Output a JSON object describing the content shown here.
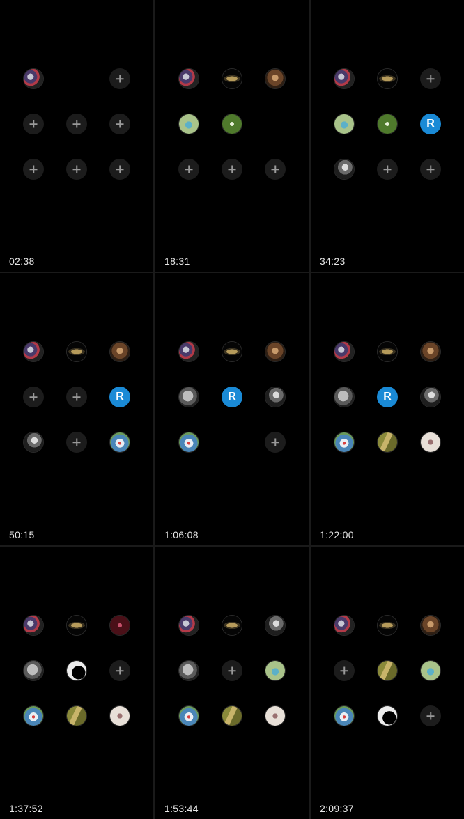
{
  "panels": [
    {
      "time": "02:38",
      "slots": [
        [
          "cards",
          null,
          "add"
        ],
        [
          "add",
          "add",
          "add"
        ],
        [
          "add",
          "add",
          "add"
        ]
      ]
    },
    {
      "time": "18:31",
      "slots": [
        [
          "cards",
          "car-logo",
          "coffee"
        ],
        [
          "drink",
          "saudi-emblem",
          null
        ],
        [
          "add",
          "add",
          "add"
        ]
      ]
    },
    {
      "time": "34:23",
      "slots": [
        [
          "cards",
          "car-logo",
          "add"
        ],
        [
          "drink",
          "saudi-emblem",
          "letter-r"
        ],
        [
          "portrait-bw",
          "add",
          "add"
        ]
      ]
    },
    {
      "time": "50:15",
      "slots": [
        [
          "cards",
          "car-logo",
          "coffee"
        ],
        [
          "add",
          "add",
          "letter-r"
        ],
        [
          "portrait-bw",
          "add",
          "flag-photo"
        ]
      ]
    },
    {
      "time": "1:06:08",
      "slots": [
        [
          "cards",
          "car-logo",
          "coffee"
        ],
        [
          "moon",
          "letter-r",
          "portrait-bw"
        ],
        [
          "flag-photo",
          null,
          "add"
        ]
      ]
    },
    {
      "time": "1:22:00",
      "slots": [
        [
          "cards",
          "car-logo",
          "coffee"
        ],
        [
          "moon",
          "letter-r",
          "portrait-bw"
        ],
        [
          "flag-photo",
          "road",
          "sketch"
        ]
      ]
    },
    {
      "time": "1:37:52",
      "slots": [
        [
          "cards",
          "car-logo",
          "palm-red"
        ],
        [
          "moon",
          "silhouette",
          "add"
        ],
        [
          "flag-photo",
          "road",
          "sketch"
        ]
      ]
    },
    {
      "time": "1:53:44",
      "slots": [
        [
          "cards",
          "car-logo",
          "portrait-bw"
        ],
        [
          "moon",
          "add",
          "drink"
        ],
        [
          "flag-photo",
          "road",
          "sketch"
        ]
      ]
    },
    {
      "time": "2:09:37",
      "slots": [
        [
          "cards",
          "car-logo",
          "coffee"
        ],
        [
          "add",
          "road",
          "drink"
        ],
        [
          "flag-photo",
          "silhouette",
          "add"
        ]
      ]
    }
  ],
  "letter_label": "R",
  "colors": {
    "background": "#000000",
    "divider": "#1a1a1a",
    "accent_blue": "#1a8ad6",
    "empty_slot": "#1c1c1c"
  }
}
